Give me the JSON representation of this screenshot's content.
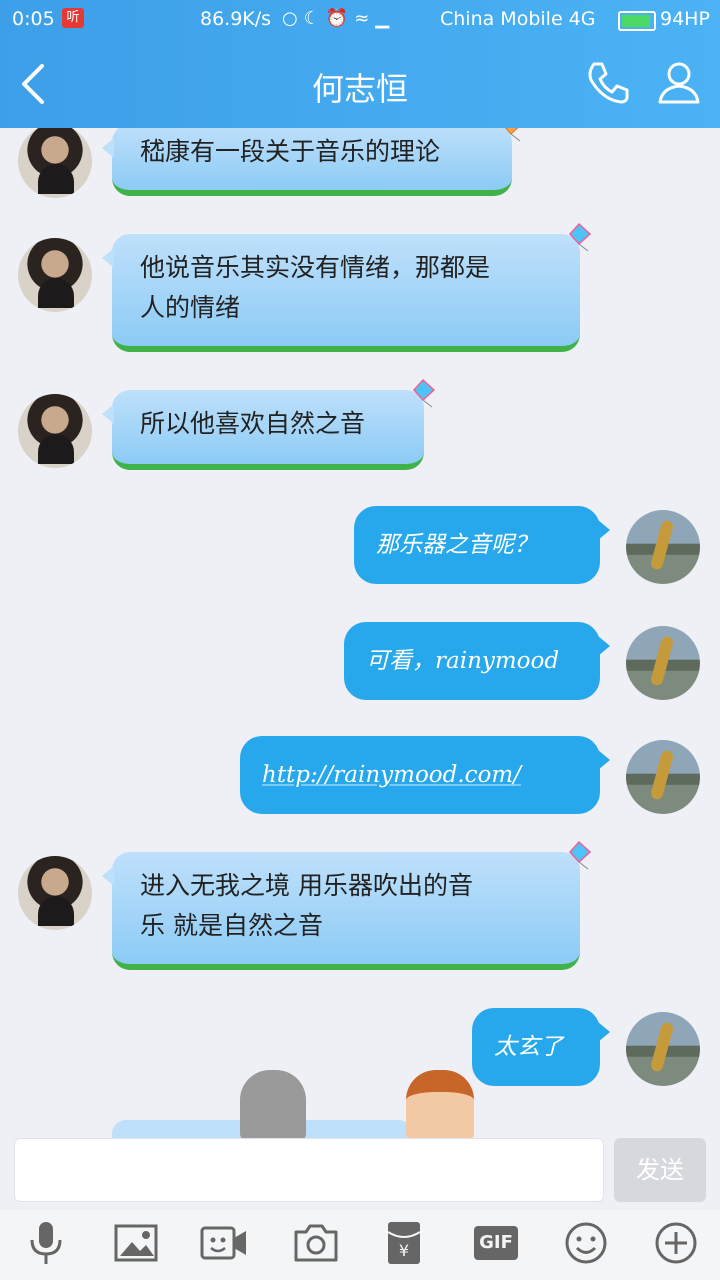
{
  "status_bar": {
    "time": "0:05",
    "badge": "听",
    "net_speed": "86.9K/s",
    "carrier": "China Mobile 4G",
    "battery": "94HP"
  },
  "header": {
    "title": "何志恒"
  },
  "messages": [
    {
      "side": "left",
      "text": "嵇康有一段关于音乐的理论"
    },
    {
      "side": "left",
      "text_lines": [
        "他说音乐其实没有情绪，那都是",
        "人的情绪"
      ]
    },
    {
      "side": "left",
      "text": "所以他喜欢自然之音"
    },
    {
      "side": "right",
      "text": "那乐器之音呢？"
    },
    {
      "side": "right",
      "text": "可看，rainymood"
    },
    {
      "side": "right",
      "text": "http://rainymood.com/"
    },
    {
      "side": "left",
      "text_lines": [
        "进入无我之境  用乐器吹出的音",
        "乐  就是自然之音"
      ]
    },
    {
      "side": "right",
      "text": "太玄了"
    }
  ],
  "input": {
    "send_label": "发送"
  },
  "toolbar": {
    "gif_label": "GIF",
    "items": [
      "microphone-icon",
      "image-icon",
      "video-icon",
      "camera-icon",
      "red-packet-icon",
      "gif-icon",
      "emoji-icon",
      "plus-icon"
    ]
  },
  "colors": {
    "header": "#3d9fe8",
    "bubble_right": "#28a8ec",
    "bubble_left": "#bfe0fb",
    "bubble_left_border": "#3fb34a"
  }
}
